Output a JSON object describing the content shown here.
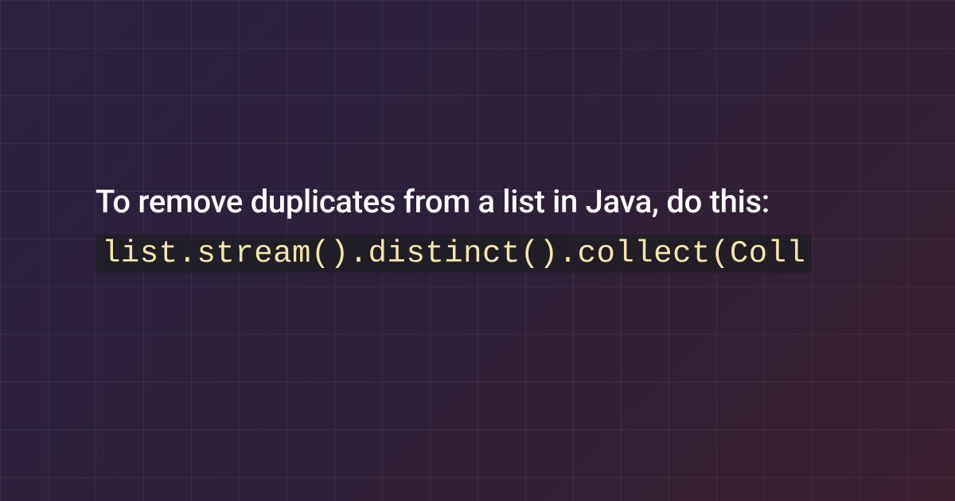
{
  "snippet": {
    "description": "To remove duplicates from a list in Java, do this:",
    "code": "list.stream().distinct().collect(Coll"
  }
}
